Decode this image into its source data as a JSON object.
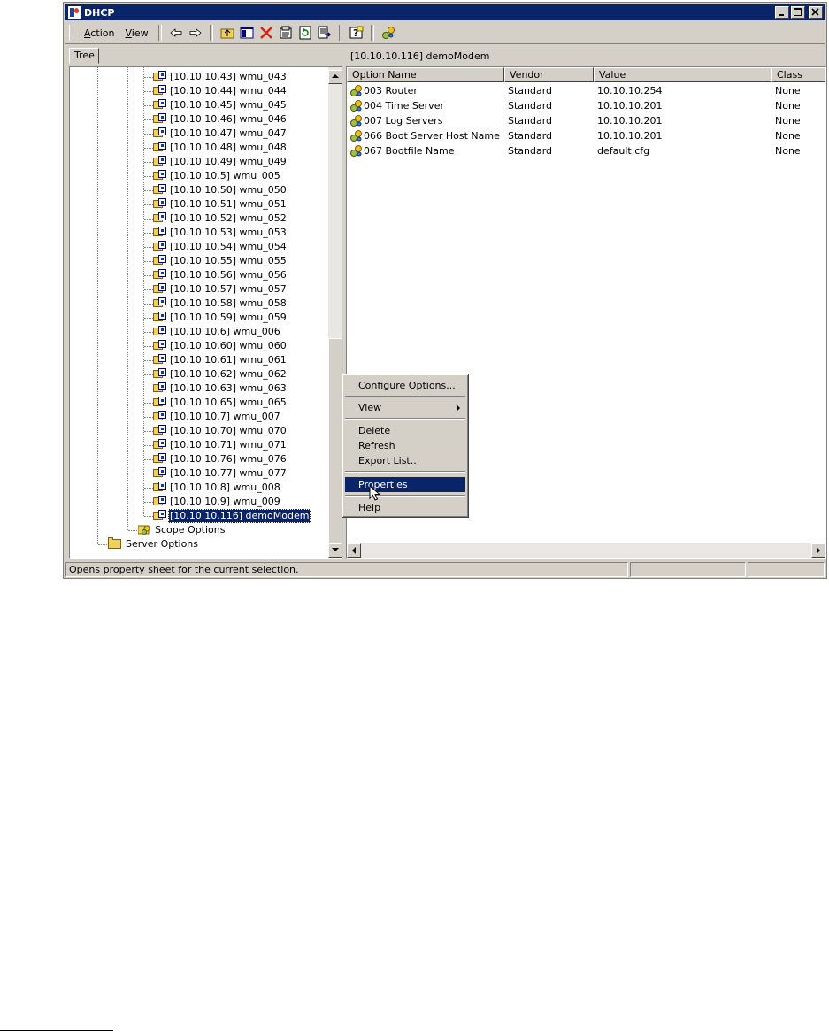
{
  "window": {
    "title": "DHCP"
  },
  "menu": {
    "action_prefix": "",
    "action_u": "A",
    "action_rest": "ction",
    "view_u": "V",
    "view_rest": "iew"
  },
  "toolbar_icons": [
    "back-arrow-icon",
    "forward-arrow-icon",
    "up-folder-icon",
    "show-hide-tree-icon",
    "delete-icon",
    "properties-icon",
    "refresh-icon",
    "export-list-icon",
    "help-icon",
    "options-icon"
  ],
  "tree": {
    "tab_label": "Tree",
    "items": [
      "[10.10.10.43] wmu_043",
      "[10.10.10.44] wmu_044",
      "[10.10.10.45] wmu_045",
      "[10.10.10.46] wmu_046",
      "[10.10.10.47] wmu_047",
      "[10.10.10.48] wmu_048",
      "[10.10.10.49] wmu_049",
      "[10.10.10.5] wmu_005",
      "[10.10.10.50] wmu_050",
      "[10.10.10.51] wmu_051",
      "[10.10.10.52] wmu_052",
      "[10.10.10.53] wmu_053",
      "[10.10.10.54] wmu_054",
      "[10.10.10.55] wmu_055",
      "[10.10.10.56] wmu_056",
      "[10.10.10.57] wmu_057",
      "[10.10.10.58] wmu_058",
      "[10.10.10.59] wmu_059",
      "[10.10.10.6] wmu_006",
      "[10.10.10.60] wmu_060",
      "[10.10.10.61] wmu_061",
      "[10.10.10.62] wmu_062",
      "[10.10.10.63] wmu_063",
      "[10.10.10.65] wmu_065",
      "[10.10.10.7] wmu_007",
      "[10.10.10.70] wmu_070",
      "[10.10.10.71] wmu_071",
      "[10.10.10.76] wmu_076",
      "[10.10.10.77] wmu_077",
      "[10.10.10.8] wmu_008",
      "[10.10.10.9] wmu_009"
    ],
    "selected_item": "[10.10.10.116] demoModem",
    "scope_options": "Scope Options",
    "server_options": "Server Options"
  },
  "right_pane": {
    "header": "[10.10.10.116] demoModem",
    "columns": [
      "Option Name",
      "Vendor",
      "Value",
      "Class"
    ],
    "rows": [
      [
        "003 Router",
        "Standard",
        "10.10.10.254",
        "None"
      ],
      [
        "004 Time Server",
        "Standard",
        "10.10.10.201",
        "None"
      ],
      [
        "007 Log Servers",
        "Standard",
        "10.10.10.201",
        "None"
      ],
      [
        "066 Boot Server Host Name",
        "Standard",
        "10.10.10.201",
        "None"
      ],
      [
        "067 Bootfile Name",
        "Standard",
        "default.cfg",
        "None"
      ]
    ]
  },
  "context_menu": {
    "configure_options": "Configure Options...",
    "view": "View",
    "delete": "Delete",
    "refresh": "Refresh",
    "export_list": "Export List...",
    "properties": "Properties",
    "help": "Help"
  },
  "status_bar": {
    "message": "Opens property sheet for the current selection."
  },
  "colors": {
    "selection": "#0a246a",
    "face": "#d4d0c8"
  }
}
